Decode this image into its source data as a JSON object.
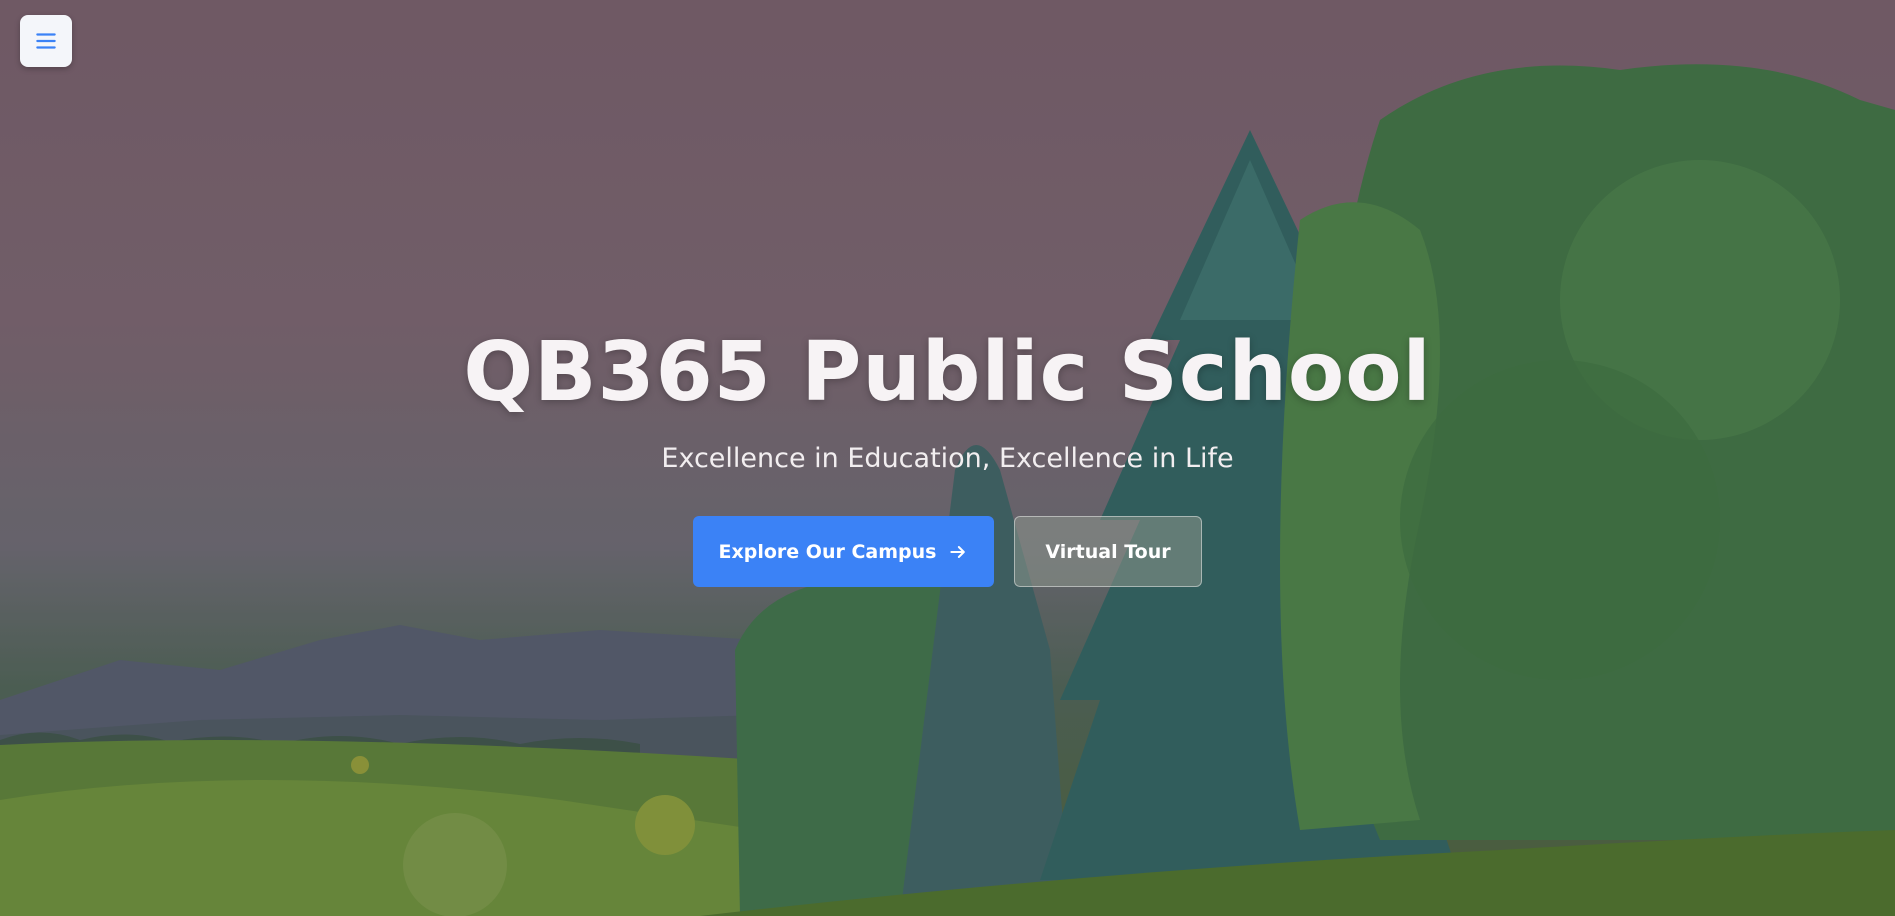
{
  "hero": {
    "title": "QB365 Public School",
    "subtitle": "Excellence in Education, Excellence in Life"
  },
  "nav": {
    "menu_icon": "hamburger-menu-icon"
  },
  "buttons": {
    "primary_label": "Explore Our Campus",
    "primary_icon": "arrow-right-icon",
    "secondary_label": "Virtual Tour"
  },
  "colors": {
    "primary_button": "#3b82f6",
    "menu_icon": "#3b82f6"
  },
  "background": {
    "description_icon": "forest-landscape-image"
  }
}
